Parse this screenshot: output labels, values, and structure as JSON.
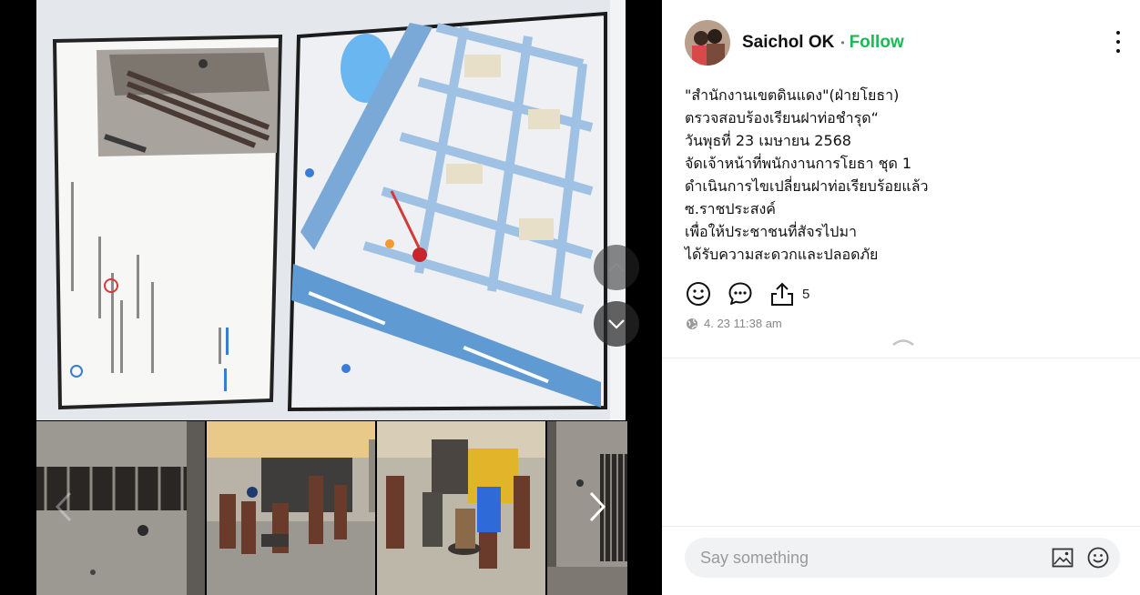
{
  "post": {
    "author": "Saichol OK",
    "separator": "•",
    "follow_label": "Follow",
    "text_lines": [
      "\"สำนักงานเขตดินแดง\"(ฝ่ายโยธา)",
      "ตรวจสอบร้องเรียนฝาท่อชำรุด“",
      "วันพุธที่ 23 เมษายน 2568",
      "จัดเจ้าหน้าที่พนักงานการโยธา ชุด 1",
      "ดำเนินการไขเปลี่ยนฝาท่อเรียบร้อยแล้ว",
      "ซ.ราชประสงค์",
      "เพื่อให้ประชาชนที่สัจรไปมา",
      "ได้รับความสะดวกและปลอดภัย"
    ],
    "share_count": "5",
    "timestamp": "4. 23 11:38 am"
  },
  "comment": {
    "placeholder": "Say something"
  },
  "icons": {
    "like": "smile-icon",
    "comment": "comment-bubble-icon",
    "share": "share-upload-icon",
    "visibility": "globe-icon",
    "image": "image-icon",
    "emoji": "emoji-icon",
    "more": "more-vertical-icon",
    "prev": "chevron-up-icon",
    "next": "chevron-down-icon"
  },
  "colors": {
    "follow": "#1db954",
    "viewer_bg": "#000000"
  }
}
